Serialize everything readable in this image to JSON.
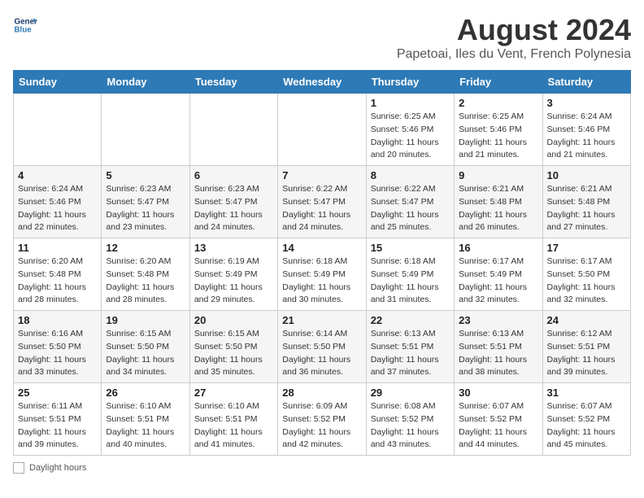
{
  "header": {
    "logo_line1": "General",
    "logo_line2": "Blue",
    "month": "August 2024",
    "location": "Papetoai, Iles du Vent, French Polynesia"
  },
  "days_of_week": [
    "Sunday",
    "Monday",
    "Tuesday",
    "Wednesday",
    "Thursday",
    "Friday",
    "Saturday"
  ],
  "footer_label": "Daylight hours",
  "weeks": [
    [
      {
        "day": "",
        "sunrise": "",
        "sunset": "",
        "daylight": ""
      },
      {
        "day": "",
        "sunrise": "",
        "sunset": "",
        "daylight": ""
      },
      {
        "day": "",
        "sunrise": "",
        "sunset": "",
        "daylight": ""
      },
      {
        "day": "",
        "sunrise": "",
        "sunset": "",
        "daylight": ""
      },
      {
        "day": "1",
        "sunrise": "Sunrise: 6:25 AM",
        "sunset": "Sunset: 5:46 PM",
        "daylight": "Daylight: 11 hours and 20 minutes."
      },
      {
        "day": "2",
        "sunrise": "Sunrise: 6:25 AM",
        "sunset": "Sunset: 5:46 PM",
        "daylight": "Daylight: 11 hours and 21 minutes."
      },
      {
        "day": "3",
        "sunrise": "Sunrise: 6:24 AM",
        "sunset": "Sunset: 5:46 PM",
        "daylight": "Daylight: 11 hours and 21 minutes."
      }
    ],
    [
      {
        "day": "4",
        "sunrise": "Sunrise: 6:24 AM",
        "sunset": "Sunset: 5:46 PM",
        "daylight": "Daylight: 11 hours and 22 minutes."
      },
      {
        "day": "5",
        "sunrise": "Sunrise: 6:23 AM",
        "sunset": "Sunset: 5:47 PM",
        "daylight": "Daylight: 11 hours and 23 minutes."
      },
      {
        "day": "6",
        "sunrise": "Sunrise: 6:23 AM",
        "sunset": "Sunset: 5:47 PM",
        "daylight": "Daylight: 11 hours and 24 minutes."
      },
      {
        "day": "7",
        "sunrise": "Sunrise: 6:22 AM",
        "sunset": "Sunset: 5:47 PM",
        "daylight": "Daylight: 11 hours and 24 minutes."
      },
      {
        "day": "8",
        "sunrise": "Sunrise: 6:22 AM",
        "sunset": "Sunset: 5:47 PM",
        "daylight": "Daylight: 11 hours and 25 minutes."
      },
      {
        "day": "9",
        "sunrise": "Sunrise: 6:21 AM",
        "sunset": "Sunset: 5:48 PM",
        "daylight": "Daylight: 11 hours and 26 minutes."
      },
      {
        "day": "10",
        "sunrise": "Sunrise: 6:21 AM",
        "sunset": "Sunset: 5:48 PM",
        "daylight": "Daylight: 11 hours and 27 minutes."
      }
    ],
    [
      {
        "day": "11",
        "sunrise": "Sunrise: 6:20 AM",
        "sunset": "Sunset: 5:48 PM",
        "daylight": "Daylight: 11 hours and 28 minutes."
      },
      {
        "day": "12",
        "sunrise": "Sunrise: 6:20 AM",
        "sunset": "Sunset: 5:48 PM",
        "daylight": "Daylight: 11 hours and 28 minutes."
      },
      {
        "day": "13",
        "sunrise": "Sunrise: 6:19 AM",
        "sunset": "Sunset: 5:49 PM",
        "daylight": "Daylight: 11 hours and 29 minutes."
      },
      {
        "day": "14",
        "sunrise": "Sunrise: 6:18 AM",
        "sunset": "Sunset: 5:49 PM",
        "daylight": "Daylight: 11 hours and 30 minutes."
      },
      {
        "day": "15",
        "sunrise": "Sunrise: 6:18 AM",
        "sunset": "Sunset: 5:49 PM",
        "daylight": "Daylight: 11 hours and 31 minutes."
      },
      {
        "day": "16",
        "sunrise": "Sunrise: 6:17 AM",
        "sunset": "Sunset: 5:49 PM",
        "daylight": "Daylight: 11 hours and 32 minutes."
      },
      {
        "day": "17",
        "sunrise": "Sunrise: 6:17 AM",
        "sunset": "Sunset: 5:50 PM",
        "daylight": "Daylight: 11 hours and 32 minutes."
      }
    ],
    [
      {
        "day": "18",
        "sunrise": "Sunrise: 6:16 AM",
        "sunset": "Sunset: 5:50 PM",
        "daylight": "Daylight: 11 hours and 33 minutes."
      },
      {
        "day": "19",
        "sunrise": "Sunrise: 6:15 AM",
        "sunset": "Sunset: 5:50 PM",
        "daylight": "Daylight: 11 hours and 34 minutes."
      },
      {
        "day": "20",
        "sunrise": "Sunrise: 6:15 AM",
        "sunset": "Sunset: 5:50 PM",
        "daylight": "Daylight: 11 hours and 35 minutes."
      },
      {
        "day": "21",
        "sunrise": "Sunrise: 6:14 AM",
        "sunset": "Sunset: 5:50 PM",
        "daylight": "Daylight: 11 hours and 36 minutes."
      },
      {
        "day": "22",
        "sunrise": "Sunrise: 6:13 AM",
        "sunset": "Sunset: 5:51 PM",
        "daylight": "Daylight: 11 hours and 37 minutes."
      },
      {
        "day": "23",
        "sunrise": "Sunrise: 6:13 AM",
        "sunset": "Sunset: 5:51 PM",
        "daylight": "Daylight: 11 hours and 38 minutes."
      },
      {
        "day": "24",
        "sunrise": "Sunrise: 6:12 AM",
        "sunset": "Sunset: 5:51 PM",
        "daylight": "Daylight: 11 hours and 39 minutes."
      }
    ],
    [
      {
        "day": "25",
        "sunrise": "Sunrise: 6:11 AM",
        "sunset": "Sunset: 5:51 PM",
        "daylight": "Daylight: 11 hours and 39 minutes."
      },
      {
        "day": "26",
        "sunrise": "Sunrise: 6:10 AM",
        "sunset": "Sunset: 5:51 PM",
        "daylight": "Daylight: 11 hours and 40 minutes."
      },
      {
        "day": "27",
        "sunrise": "Sunrise: 6:10 AM",
        "sunset": "Sunset: 5:51 PM",
        "daylight": "Daylight: 11 hours and 41 minutes."
      },
      {
        "day": "28",
        "sunrise": "Sunrise: 6:09 AM",
        "sunset": "Sunset: 5:52 PM",
        "daylight": "Daylight: 11 hours and 42 minutes."
      },
      {
        "day": "29",
        "sunrise": "Sunrise: 6:08 AM",
        "sunset": "Sunset: 5:52 PM",
        "daylight": "Daylight: 11 hours and 43 minutes."
      },
      {
        "day": "30",
        "sunrise": "Sunrise: 6:07 AM",
        "sunset": "Sunset: 5:52 PM",
        "daylight": "Daylight: 11 hours and 44 minutes."
      },
      {
        "day": "31",
        "sunrise": "Sunrise: 6:07 AM",
        "sunset": "Sunset: 5:52 PM",
        "daylight": "Daylight: 11 hours and 45 minutes."
      }
    ]
  ]
}
